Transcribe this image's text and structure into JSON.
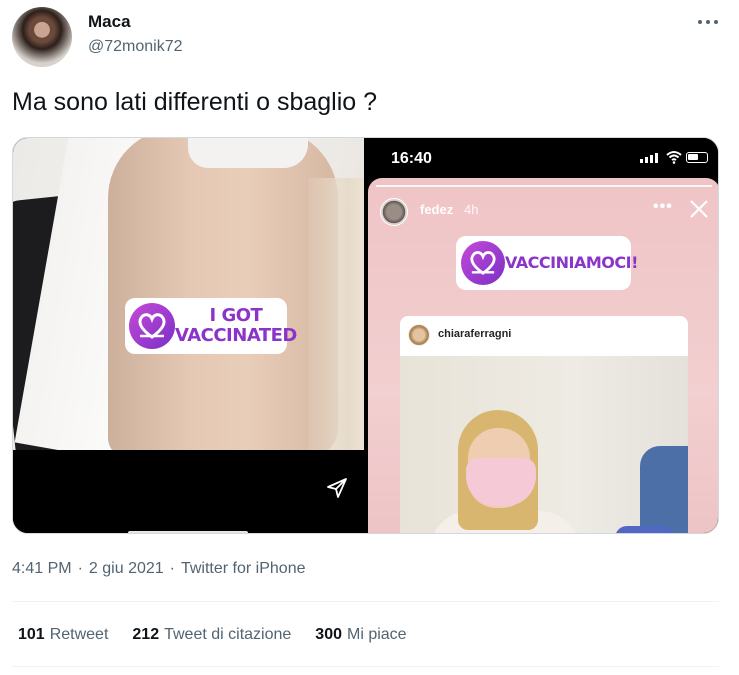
{
  "author": {
    "name": "Maca",
    "handle": "@72monik72"
  },
  "tweet": {
    "text": "Ma sono lati differenti o sbaglio ?"
  },
  "media": {
    "left": {
      "sticker_line1": "I GOT",
      "sticker_line2": "VACCINATED"
    },
    "right": {
      "status_time": "16:40",
      "story_user": "fedez",
      "story_age": "4h",
      "sticker_text": "VACCINIAMOCI!",
      "shared_post_user": "chiaraferragni"
    }
  },
  "meta": {
    "time": "4:41 PM",
    "separator1": "·",
    "date": "2 giu 2021",
    "separator2": "·",
    "source": "Twitter for iPhone"
  },
  "stats": {
    "retweets_count": "101",
    "retweets_label": "Retweet",
    "quotes_count": "212",
    "quotes_label": "Tweet di citazione",
    "likes_count": "300",
    "likes_label": "Mi piace"
  },
  "colors": {
    "text_primary": "#0f1419",
    "text_secondary": "#536471",
    "sticker_purple": "#8a34c9",
    "divider": "#eff3f4"
  },
  "icons": {
    "more": "more-horizontal-icon",
    "send": "send-icon",
    "close": "close-icon"
  }
}
